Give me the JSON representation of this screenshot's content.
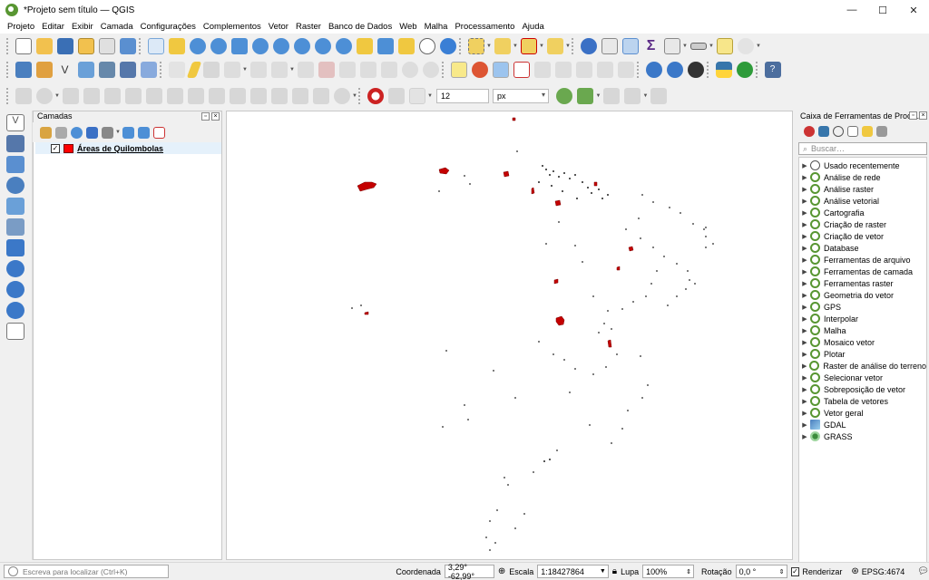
{
  "window": {
    "title": "*Projeto sem título — QGIS",
    "controls": [
      "—",
      "☐",
      "✕"
    ]
  },
  "menu": [
    "Projeto",
    "Editar",
    "Exibir",
    "Camada",
    "Configurações",
    "Complementos",
    "Vetor",
    "Raster",
    "Banco de Dados",
    "Web",
    "Malha",
    "Processamento",
    "Ajuda"
  ],
  "toolbar3": {
    "font_size": "12",
    "unit": "px"
  },
  "layers_panel": {
    "title": "Camadas",
    "layer": {
      "name": "Áreas de Quilombolas",
      "checked": "✓",
      "color": "#ff0000"
    }
  },
  "toolbox": {
    "title": "Caixa de Ferramentas de Proc…",
    "search_placeholder": "Buscar…",
    "items": [
      "Usado recentemente",
      "Análise de rede",
      "Análise raster",
      "Análise vetorial",
      "Cartografia",
      "Criação de raster",
      "Criação de vetor",
      "Database",
      "Ferramentas de arquivo",
      "Ferramentas de camada",
      "Ferramentas raster",
      "Geometria do vetor",
      "GPS",
      "Interpolar",
      "Malha",
      "Mosaico vetor",
      "Plotar",
      "Raster de análise do terreno",
      "Selecionar vetor",
      "Sobreposição de vetor",
      "Tabela de vetores",
      "Vetor geral",
      "GDAL",
      "GRASS"
    ]
  },
  "status": {
    "locator_placeholder": "Escreva para localizar (Ctrl+K)",
    "coord_label": "Coordenada",
    "coord_value": "3,29° -62,99°",
    "scale_label": "Escala",
    "scale_value": "1:18427864",
    "magnifier_label": "Lupa",
    "magnifier_value": "100%",
    "rotation_label": "Rotação",
    "rotation_value": "0,0 °",
    "render_label": "Renderizar",
    "render_checked": "✓",
    "crs": "EPSG:4674"
  }
}
